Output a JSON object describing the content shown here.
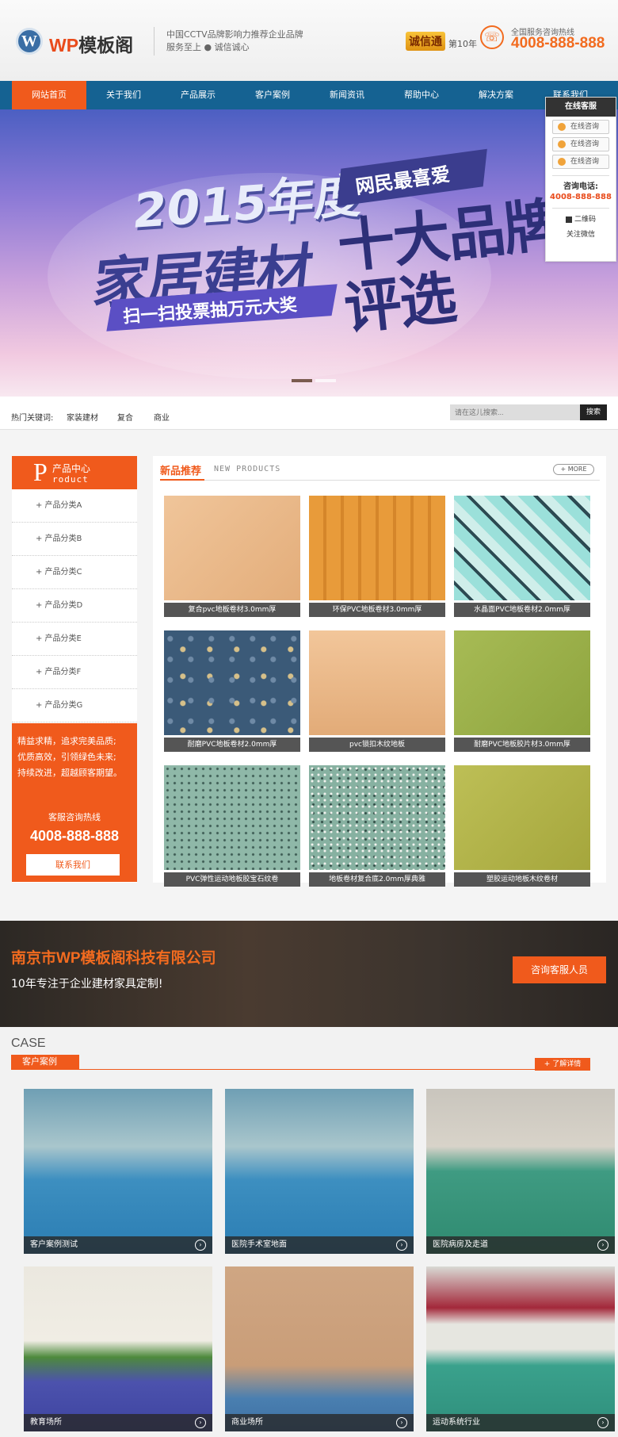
{
  "header": {
    "logo_letter": "W",
    "brand_prefix": "WP",
    "brand_suffix": "模板阁",
    "slogan_line1": "中国CCTV品牌影响力推荐企业品牌",
    "slogan_line2": "服务至上 ● 诚信诚心",
    "badge_text": "诚信通",
    "years": "第10年",
    "phone_icon": "phone-icon",
    "hotline_label": "全国服务咨询热线",
    "hotline_number": "4008-888-888"
  },
  "nav": {
    "items": [
      "网站首页",
      "关于我们",
      "产品展示",
      "客户案例",
      "新闻资讯",
      "帮助中心",
      "解决方案",
      "联系我们"
    ],
    "active_index": 0
  },
  "banner": {
    "year_text": "2015年度",
    "main_text": "家居建材",
    "sub_text": "扫一扫投票抽万元大奖",
    "tag_text": "网民最喜爱",
    "big_line1": "十大品牌",
    "big_line2": "评选",
    "slides": 2,
    "active_slide": 0
  },
  "customer_service": {
    "title": "在线客服",
    "buttons": [
      "在线咨询",
      "在线咨询",
      "在线咨询"
    ],
    "tel_label": "咨询电话:",
    "tel": "4008-888-888",
    "qr_label": "二维码",
    "wechat_label": "关注微信"
  },
  "search": {
    "label": "热门关键词:",
    "keywords": [
      "家装建材",
      "复合",
      "商业"
    ],
    "placeholder": "请在这儿搜索...",
    "button": "搜索"
  },
  "sidebar": {
    "letter": "P",
    "title": "产品中心",
    "title_en": "roduct",
    "items": [
      "+ 产品分类A",
      "+ 产品分类B",
      "+ 产品分类C",
      "+ 产品分类D",
      "+ 产品分类E",
      "+ 产品分类F",
      "+ 产品分类G"
    ],
    "promo_lines": [
      "精益求精，追求完美品质;",
      "优质高效，引领绿色未来;",
      "持续改进，超越顾客期望。"
    ],
    "hotline_label": "客服咨询热线",
    "hotline": "4008-888-888",
    "contact_button": "联系我们"
  },
  "products": {
    "title": "新品推荐",
    "title_en": "NEW PRODUCTS",
    "more": "+ MORE",
    "items": [
      {
        "caption": "复合pvc地板卷材3.0mm厚",
        "color": "#e8b98a"
      },
      {
        "caption": "环保PVC地板卷材3.0mm厚",
        "color": "#e59a3a"
      },
      {
        "caption": "水晶面PVC地板卷材2.0mm厚",
        "color": "#8fd6d0"
      },
      {
        "caption": "耐磨PVC地板卷材2.0mm厚",
        "color": "#3e5e7e"
      },
      {
        "caption": "pvc锁扣木纹地板",
        "color": "#e6b58a"
      },
      {
        "caption": "耐磨PVC地板胶片材3.0mm厚",
        "color": "#9aae45"
      },
      {
        "caption": "PVC弹性运动地板胶宝石纹卷",
        "color": "#8fb8a8"
      },
      {
        "caption": "地板卷材复合底2.0mm厚典雅",
        "color": "#8ab4a4"
      },
      {
        "caption": "塑胶运动地板木纹卷材",
        "color": "#b1b24a"
      }
    ]
  },
  "company": {
    "name": "南京市WP模板阁科技有限公司",
    "tagline": "10年专注于企业建材家具定制!",
    "button": "咨询客服人员"
  },
  "cases": {
    "title_en": "CASE",
    "title_cn": "客户案例",
    "more": "+ 了解详情",
    "items": [
      {
        "caption": "客户案例测试",
        "color": "#3b8fb5"
      },
      {
        "caption": "医院手术室地面",
        "color": "#3b8fb5"
      },
      {
        "caption": "医院病房及走道",
        "color": "#2f8f7a"
      },
      {
        "caption": "教育场所",
        "color": "#4a4fa8"
      },
      {
        "caption": "商业场所",
        "color": "#c9a07a"
      },
      {
        "caption": "运动系统行业",
        "color": "#3b9a8a"
      }
    ]
  }
}
